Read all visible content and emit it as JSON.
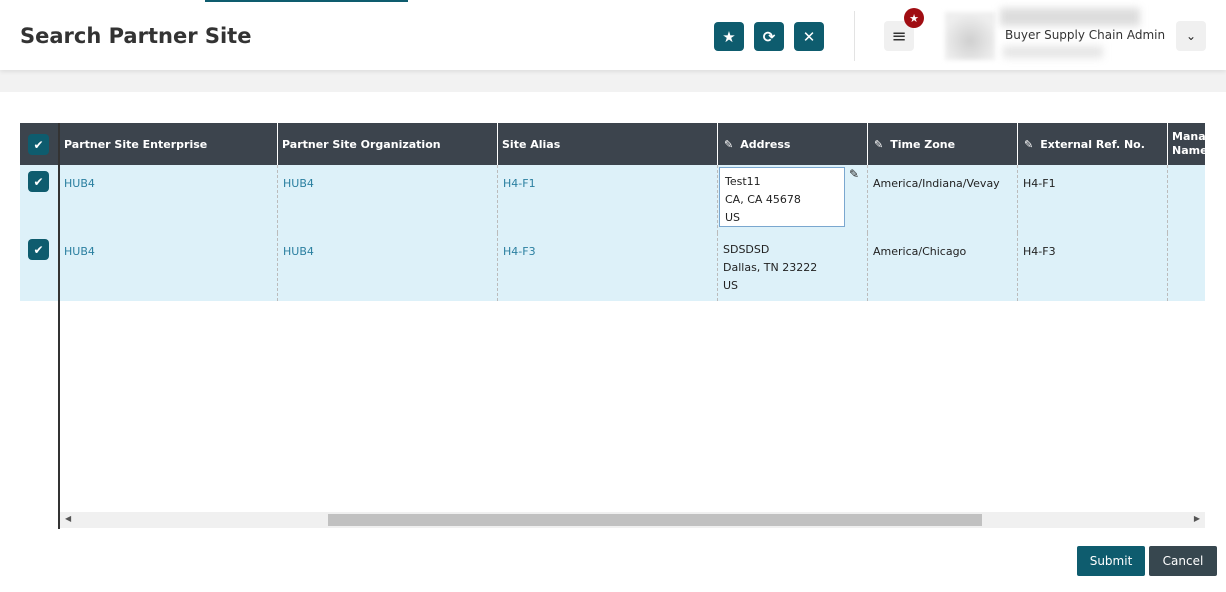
{
  "header": {
    "title": "Search Partner Site",
    "role": "Buyer Supply Chain Admin",
    "buttons": [
      "star-icon",
      "refresh-icon",
      "close-icon"
    ]
  },
  "colors": {
    "primary": "#0e5c6e",
    "header_bg": "#3c444d",
    "row_bg": "#ddf1f9",
    "badge": "#a00d12",
    "cancel": "#37474f"
  },
  "table": {
    "columns": [
      "Partner Site Enterprise",
      "Partner Site Organization",
      "Site Alias",
      "Address",
      "Time Zone",
      "External Ref. No.",
      "Manag Name"
    ],
    "rows": [
      {
        "enterprise": "HUB4",
        "organization": "HUB4",
        "alias": "H4-F1",
        "address": [
          "Test11",
          "CA, CA 45678",
          "US"
        ],
        "timezone": "America/Indiana/Vevay",
        "extref": "H4-F1",
        "checked": true
      },
      {
        "enterprise": "HUB4",
        "organization": "HUB4",
        "alias": "H4-F3",
        "address": [
          "SDSDSD",
          "Dallas, TN 23222",
          "US"
        ],
        "timezone": "America/Chicago",
        "extref": "H4-F3",
        "checked": true
      }
    ]
  },
  "actions": {
    "submit": "Submit",
    "cancel": "Cancel"
  }
}
